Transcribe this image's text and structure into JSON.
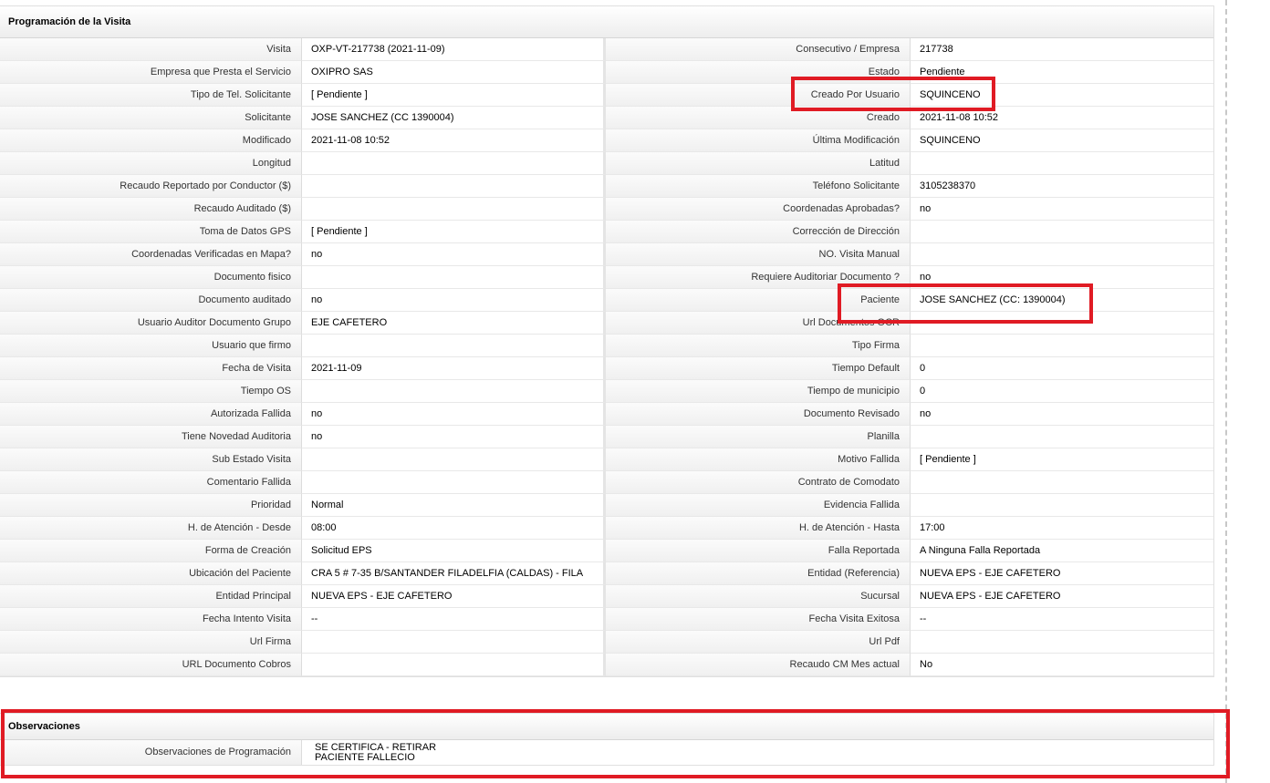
{
  "programacion": {
    "title": "Programación de la Visita",
    "rows": [
      [
        "Visita",
        "OXP-VT-217738 (2021-11-09)",
        "Consecutivo / Empresa",
        "217738"
      ],
      [
        "Empresa que Presta el Servicio",
        "OXIPRO SAS",
        "Estado",
        "Pendiente"
      ],
      [
        "Tipo de Tel. Solicitante",
        "[ Pendiente ]",
        "Creado Por Usuario",
        "SQUINCENO"
      ],
      [
        "Solicitante",
        "JOSE SANCHEZ (CC 1390004)",
        "Creado",
        "2021-11-08 10:52"
      ],
      [
        "Modificado",
        "2021-11-08 10:52",
        "Última Modificación",
        " SQUINCENO"
      ],
      [
        "Longitud",
        "",
        "Latitud",
        ""
      ],
      [
        "Recaudo Reportado por Conductor ($)",
        "",
        "Teléfono Solicitante",
        "3105238370"
      ],
      [
        "Recaudo Auditado ($)",
        "",
        "Coordenadas Aprobadas?",
        " no"
      ],
      [
        "Toma de Datos GPS",
        "[ Pendiente ]",
        "Corrección de Dirección",
        ""
      ],
      [
        "Coordenadas Verificadas en Mapa?",
        " no",
        "NO. Visita Manual",
        ""
      ],
      [
        "Documento fisico",
        "",
        "Requiere Auditoriar Documento ?",
        " no"
      ],
      [
        "Documento auditado",
        " no",
        "Paciente",
        "JOSE SANCHEZ (CC: 1390004)"
      ],
      [
        "Usuario Auditor Documento Grupo",
        "EJE CAFETERO",
        "Url Documentos OCR",
        ""
      ],
      [
        "Usuario que firmo",
        "",
        "Tipo Firma",
        ""
      ],
      [
        "Fecha de Visita",
        " 2021-11-09",
        "Tiempo Default",
        "0"
      ],
      [
        "Tiempo OS",
        "",
        "Tiempo de municipio",
        "0"
      ],
      [
        "Autorizada Fallida",
        " no",
        "Documento Revisado",
        " no"
      ],
      [
        "Tiene Novedad Auditoria",
        " no",
        "Planilla",
        ""
      ],
      [
        "Sub Estado Visita",
        "",
        "Motivo Fallida",
        "[ Pendiente ]"
      ],
      [
        "Comentario Fallida",
        "",
        "Contrato de Comodato",
        ""
      ],
      [
        "Prioridad",
        "Normal",
        "Evidencia Fallida",
        ""
      ],
      [
        "H. de Atención - Desde",
        "08:00",
        "H. de Atención - Hasta",
        "17:00"
      ],
      [
        "Forma de Creación",
        "Solicitud EPS",
        "Falla Reportada",
        "A Ninguna Falla Reportada"
      ],
      [
        "Ubicación del Paciente",
        "CRA 5 # 7-35 B/SANTANDER FILADELFIA (CALDAS) - FILA",
        "Entidad (Referencia)",
        "NUEVA EPS - EJE CAFETERO"
      ],
      [
        "Entidad Principal",
        "NUEVA EPS - EJE CAFETERO",
        "Sucursal",
        "NUEVA EPS - EJE CAFETERO"
      ],
      [
        "Fecha Intento Visita",
        "--",
        "Fecha Visita Exitosa",
        "--"
      ],
      [
        "Url Firma",
        "",
        "Url Pdf",
        ""
      ],
      [
        "URL Documento Cobros",
        "",
        "Recaudo CM Mes actual",
        "No"
      ]
    ]
  },
  "observaciones": {
    "title": "Observaciones",
    "label": "Observaciones de Programación",
    "lines": [
      " SE CERTIFICA - RETIRAR",
      "PACIENTE FALLECIO"
    ]
  },
  "colors": {
    "highlight": "#e01b24"
  }
}
